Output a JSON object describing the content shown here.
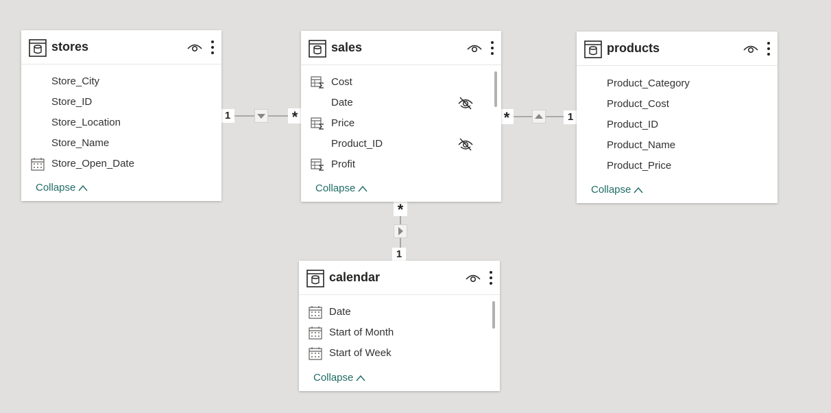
{
  "tables": {
    "stores": {
      "title": "stores",
      "fields": [
        "Store_City",
        "Store_ID",
        "Store_Location",
        "Store_Name",
        "Store_Open_Date"
      ],
      "collapse_label": "Collapse"
    },
    "sales": {
      "title": "sales",
      "fields": [
        "Cost",
        "Date",
        "Price",
        "Product_ID",
        "Profit"
      ],
      "collapse_label": "Collapse"
    },
    "products": {
      "title": "products",
      "fields": [
        "Product_Category",
        "Product_Cost",
        "Product_ID",
        "Product_Name",
        "Product_Price"
      ],
      "collapse_label": "Collapse"
    },
    "calendar": {
      "title": "calendar",
      "fields": [
        "Date",
        "Start of Month",
        "Start of Week"
      ],
      "collapse_label": "Collapse"
    }
  },
  "relationships": {
    "stores_sales": {
      "one": "1",
      "many": "*"
    },
    "products_sales": {
      "one": "1",
      "many": "*"
    },
    "calendar_sales": {
      "one": "1",
      "many": "*"
    }
  },
  "colors": {
    "canvas": "#e1e0df",
    "accent_link": "#1f6c66",
    "line": "#8a8886"
  },
  "icons": {
    "table_header": "table-icon",
    "visibility": "eye-icon",
    "menu": "more-options-icon",
    "measure": "measure-sigma-icon",
    "date": "calendar-icon",
    "hidden_field": "hidden-eye-icon",
    "collapse": "chevron-up-icon"
  }
}
